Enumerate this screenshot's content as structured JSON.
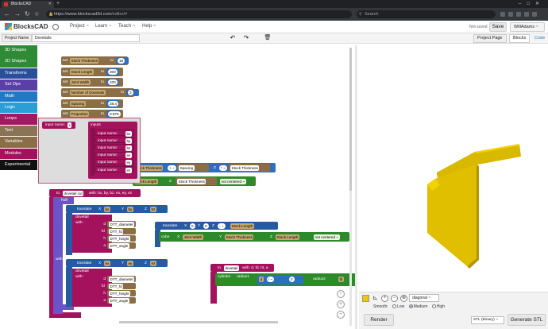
{
  "browser": {
    "tab_title": "BlocksCAD",
    "url_host": "https://www.blockscad3d.com",
    "url_path": "/editor/#",
    "search_placeholder": "Search"
  },
  "app": {
    "logo": "BlocksCAD",
    "menus": [
      "Project ~",
      "Learn ~",
      "Teach ~",
      "Help ~"
    ],
    "save_status": "Not saved",
    "save_label": "Save",
    "user": "WillAdams ~"
  },
  "toolbar": {
    "project_name_label": "Project Name",
    "project_name_value": "Dovetails",
    "tabs": [
      "Project Page",
      "Blocks",
      "Code"
    ]
  },
  "categories": [
    {
      "label": "3D Shapes",
      "color": "#2e8a35"
    },
    {
      "label": "2D Shapes",
      "color": "#2e8a35"
    },
    {
      "label": "Transforms",
      "color": "#2a4d9c"
    },
    {
      "label": "Set Ops",
      "color": "#5b3fa6"
    },
    {
      "label": "Math",
      "color": "#1f78c8"
    },
    {
      "label": "Logic",
      "color": "#2a9fd6"
    },
    {
      "label": "Loops",
      "color": "#a01866"
    },
    {
      "label": "Text",
      "color": "#8b7455"
    },
    {
      "label": "Variables",
      "color": "#8b6e45"
    },
    {
      "label": "Modules",
      "color": "#a4125d"
    },
    {
      "label": "Experimental",
      "color": "#111111"
    }
  ],
  "workspace": {
    "set_blocks": [
      {
        "name": "Stock Thickness",
        "value": "19"
      },
      {
        "name": "Stock Length",
        "value": "200"
      },
      {
        "name": "Joint Width",
        "value": "100"
      },
      {
        "name": "Number of Dovetails",
        "value": "3"
      },
      {
        "name": "Spacing",
        "value": "28.4"
      },
      {
        "name": "Proportion",
        "value": "0.875"
      }
    ],
    "flyout": {
      "input_name_label": "input name:",
      "x": "x",
      "inputs_label": "inputs",
      "input_rows": [
        "bx",
        "by",
        "bz",
        "ex",
        "ey",
        "ez"
      ]
    },
    "top_row": {
      "v1": "Stock Thickness",
      "op1": "+ ~",
      "v2": "Spacing",
      "z": "Z",
      "op2": "* ~",
      "v3": "Stock Thickness"
    },
    "row2": {
      "v1": "Stock Length",
      "z": "Z",
      "v2": "Stock Thickness",
      "dd": "not centered ~"
    },
    "module": {
      "to": "to",
      "name": "dovetail cut",
      "params": "with: bx, by, bz, ex, ey, ez",
      "hull": "hull",
      "with": "with",
      "translate1": {
        "label": "translate",
        "x": "X",
        "xv": "bx",
        "y": "Y",
        "yv": "by",
        "z": "Z",
        "zv": "bz"
      },
      "translate2": {
        "label": "translate",
        "x": "X",
        "xv": "ex",
        "y": "Y",
        "yv": "ey",
        "z": "Z",
        "zv": "ez"
      },
      "dovetail1": {
        "label": "dovetail",
        "with": "with:",
        "rows": [
          [
            "d",
            "DTT_diameter"
          ],
          [
            "fd",
            "DTT_fd"
          ],
          [
            "h",
            "DTT_height"
          ],
          [
            "a",
            "DTT_angle"
          ]
        ]
      },
      "dovetail2": {
        "label": "dovetail",
        "with": "with:",
        "rows": [
          [
            "d",
            "DTT_diameter"
          ],
          [
            "fd",
            "DTT_fd"
          ],
          [
            "h",
            "DTT_height"
          ],
          [
            "a",
            "DTT_angle"
          ]
        ]
      }
    },
    "translate3": {
      "label": "translate",
      "x": "X",
      "xv": "0",
      "y": "Y",
      "yv": "0",
      "z": "Z",
      "op": "- ~",
      "zv": "Stock Length"
    },
    "cube": {
      "label": "cube",
      "x": "X",
      "xv": "Joint Width",
      "y": "Y",
      "yv": "Stock Thickness",
      "z": "Z",
      "zv": "Stock Length",
      "dd": "not centered ~"
    },
    "module2": {
      "to": "to",
      "name": "dovetail",
      "params": "with: d, fd, ht, a",
      "cylinder": "cylinder",
      "radius1": "radius1",
      "op": "/ ~",
      "a": "d",
      "b": "2",
      "radius2": "radius2",
      "c": "fd"
    }
  },
  "viewer": {
    "view_select": "diagonal ~",
    "smooth_label": "Smooth:",
    "smooth_options": [
      "Low",
      "Medium",
      "High"
    ],
    "smooth_selected": "Medium",
    "render_label": "Render",
    "stl_select": "STL (Binary) ~",
    "generate_label": "Generate STL",
    "model_color": "#e6c200"
  }
}
